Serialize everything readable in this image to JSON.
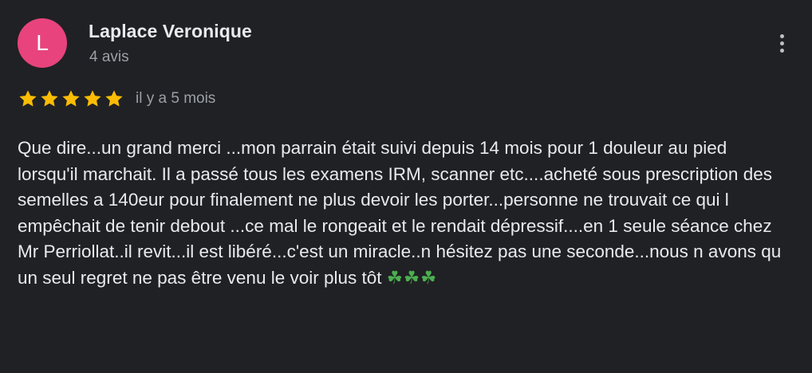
{
  "author": {
    "initial": "L",
    "name": "Laplace Veronique",
    "reviews_count": "4 avis"
  },
  "colors": {
    "avatar_background": "#e8437d",
    "star": "#fbbc04",
    "background": "#202124"
  },
  "rating": {
    "stars": 5,
    "max": 5,
    "date": "il y a 5 mois"
  },
  "review": {
    "text": "Que dire...un grand merci ...mon parrain était suivi depuis 14 mois pour 1 douleur au pied lorsqu'il marchait. Il a passé tous les examens IRM, scanner etc....acheté sous prescription des semelles a 140eur pour finalement ne plus devoir les porter...personne ne trouvait ce qui l empêchait de tenir debout ...ce mal le rongeait et le rendait dépressif....en 1 seule séance chez Mr Perriollat..il revit...il est libéré...c'est un miracle..n hésitez pas une seconde...nous n avons qu un seul regret ne pas être venu le voir plus tôt",
    "emoji": "☘☘☘"
  },
  "icons": {
    "more": "more-vert-icon",
    "star": "star-icon"
  }
}
